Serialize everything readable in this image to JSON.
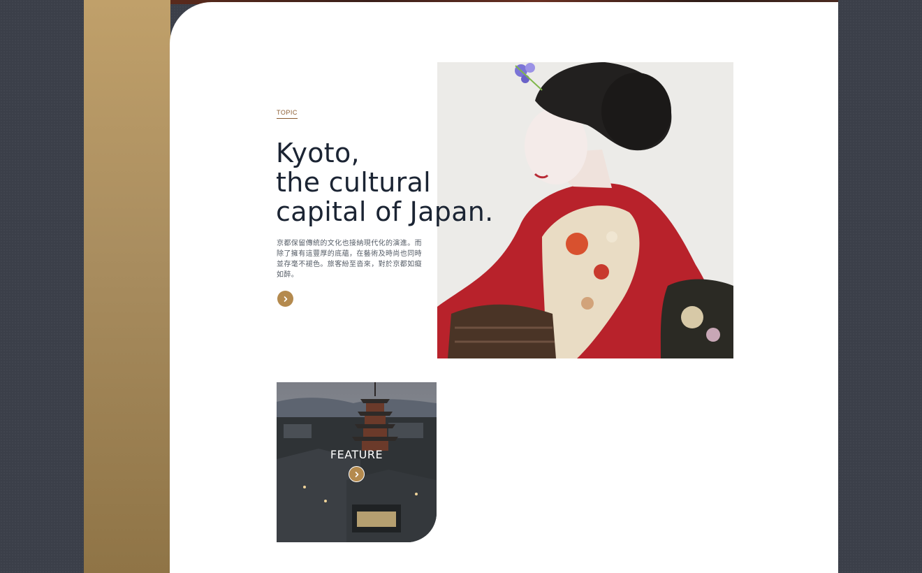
{
  "hero": {
    "topic_label": "TOPIC",
    "title_line1": "Kyoto,",
    "title_line2": "the cultural",
    "title_line3": "capital of Japan.",
    "description": "京都保留傳統的文化也接納現代化的演進。而除了擁有這豐厚的底蘊，在藝術及時尚也同時並存毫不褪色。旅客紛至沓來，對於京都如癡如醉。",
    "more_icon": "chevron-right-icon"
  },
  "feature": {
    "label": "FEATURE",
    "more_icon": "chevron-right-icon"
  },
  "colors": {
    "gold_accent": "#b48a4e",
    "gold_strip": "#a98d5f",
    "heading": "#1b2433",
    "background": "#3b3f49"
  }
}
